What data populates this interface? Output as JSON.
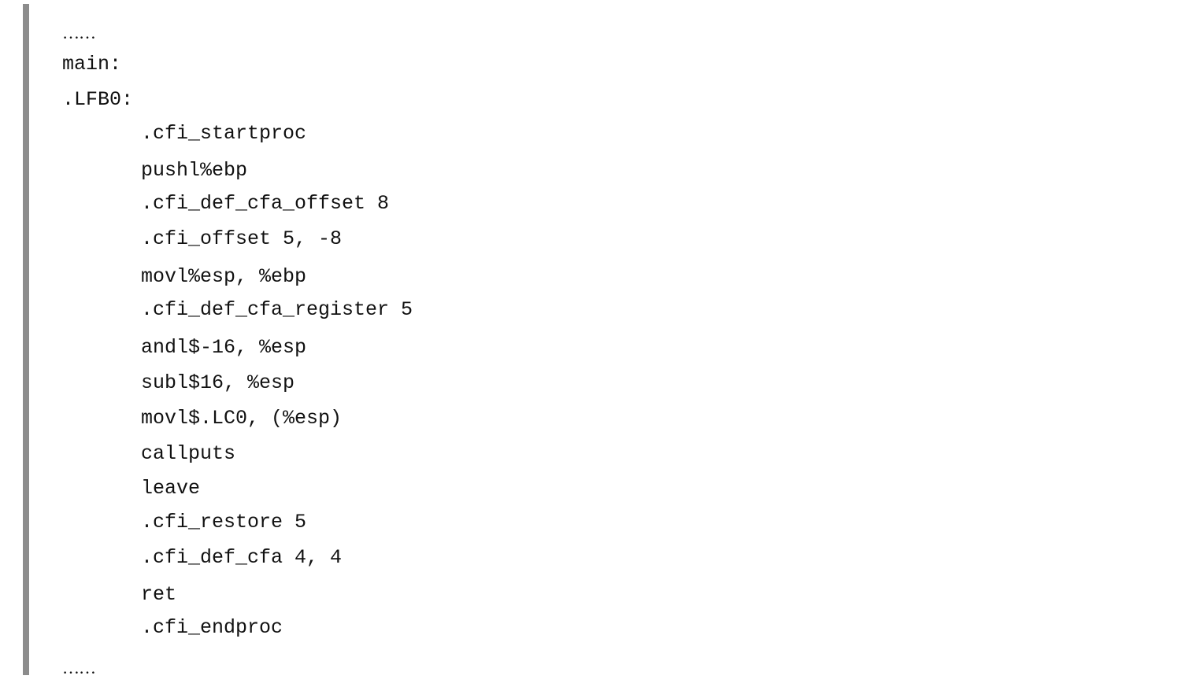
{
  "code": {
    "lines": [
      "……",
      "main:",
      ".LFB0:",
      ".cfi_startproc",
      "pushl%ebp",
      ".cfi_def_cfa_offset 8",
      ".cfi_offset 5, -8",
      "movl%esp, %ebp",
      ".cfi_def_cfa_register 5",
      "andl$-16, %esp",
      "subl$16, %esp",
      "movl$.LC0, (%esp)",
      "callputs",
      "leave",
      ".cfi_restore 5",
      ".cfi_def_cfa 4, 4",
      "ret",
      ".cfi_endproc",
      "……"
    ]
  }
}
